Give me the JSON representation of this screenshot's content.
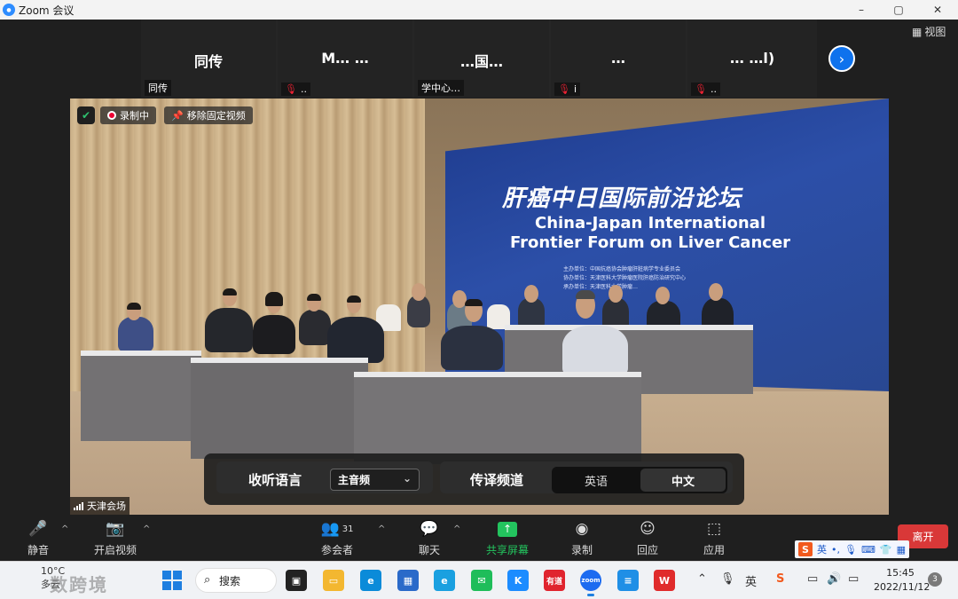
{
  "window": {
    "title": "Zoom 会议",
    "controls": [
      "–",
      "▢",
      "✕"
    ]
  },
  "strip": {
    "view_label": "视图",
    "tiles": [
      {
        "name": "同传",
        "footer": "同传"
      },
      {
        "name": "M… …",
        "footer": ".."
      },
      {
        "name": "…国…",
        "footer": "学中心…"
      },
      {
        "name": "…",
        "footer": "i"
      },
      {
        "name": "… …l)",
        "footer": ".."
      }
    ]
  },
  "video": {
    "recording_label": "录制中",
    "unpin_label": "移除固定视频",
    "venue_label": "天津会场",
    "backdrop": {
      "title_cn": "肝癌中日国际前沿论坛",
      "title_en": "China-Japan International Frontier Forum on Liver Cancer",
      "line1": "主办单位：中国抗癌协会肿瘤肝脏病学专业委员会",
      "line2": "协办单位：天津医科大学肿瘤医院肝癌防治研究中心",
      "line3": "承办单位：天津医科大学肿瘤…"
    }
  },
  "interpretation": {
    "listen_label": "收听语言",
    "listen_value": "主音频",
    "channel_label": "传译频道",
    "channels": [
      "英语",
      "中文"
    ],
    "active_channel": "中文"
  },
  "toolbar": {
    "mute": "静音",
    "video": "开启视频",
    "participants": "参会者",
    "participants_count": "31",
    "chat": "聊天",
    "share": "共享屏幕",
    "record": "录制",
    "reactions": "回应",
    "apps": "应用",
    "leave": "离开"
  },
  "ime": {
    "lang": "英"
  },
  "taskbar": {
    "weather_temp": "10°C",
    "weather_desc": "多云",
    "watermark": "数跨境",
    "search": "搜索",
    "tray_lang": "英",
    "time": "15:45",
    "date": "2022/11/12",
    "notifications": "3"
  },
  "colors": {
    "zoom_blue": "#0e72ed",
    "share_green": "#23c45e",
    "leave_red": "#d93838",
    "backdrop_blue": "#2c4fa8"
  }
}
